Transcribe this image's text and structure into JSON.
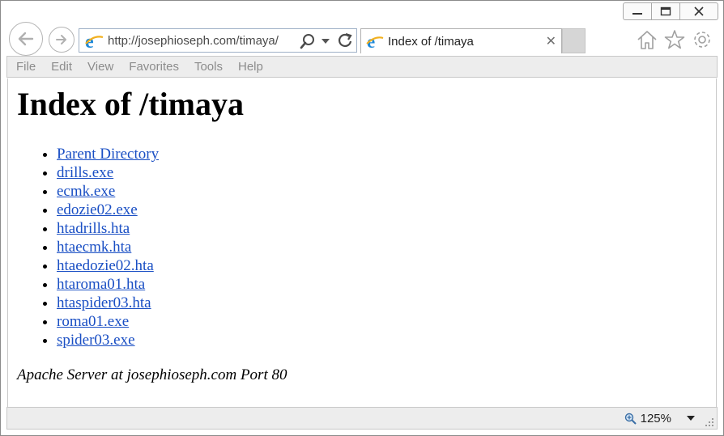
{
  "window": {
    "controls": {
      "minimize": "minimize",
      "restore": "restore",
      "close": "close"
    }
  },
  "address_bar": {
    "url": "http://josephioseph.com/timaya/"
  },
  "tab": {
    "title": "Index of /timaya"
  },
  "menu": {
    "items": [
      "File",
      "Edit",
      "View",
      "Favorites",
      "Tools",
      "Help"
    ]
  },
  "page": {
    "title": "Index of /timaya",
    "links": [
      "Parent Directory",
      "drills.exe",
      "ecmk.exe",
      "edozie02.exe",
      "htadrills.hta",
      "htaecmk.hta",
      "htaedozie02.hta",
      "htaroma01.hta",
      "htaspider03.hta",
      "roma01.exe",
      "spider03.exe"
    ],
    "server_signature": "Apache Server at josephioseph.com Port 80"
  },
  "status": {
    "zoom": "125%"
  },
  "colors": {
    "link": "#1a4fc4",
    "ie_blue": "#1e88d8",
    "ie_gold": "#f2b01e"
  },
  "icons": [
    "back-icon",
    "forward-icon",
    "ie-logo-icon",
    "search-icon",
    "refresh-icon",
    "home-icon",
    "favorites-star-icon",
    "settings-gear-icon",
    "zoom-icon",
    "resize-grip-icon"
  ]
}
